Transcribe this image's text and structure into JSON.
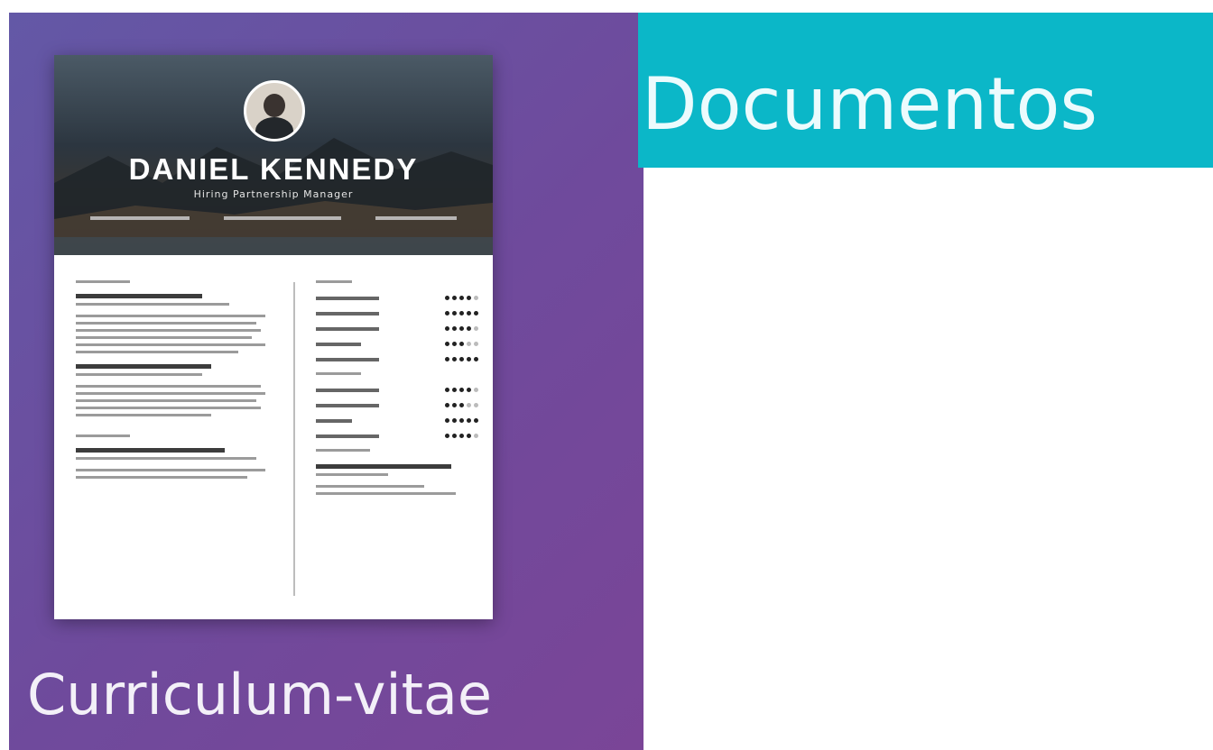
{
  "tiles": {
    "cv": {
      "label": "Curriculum-vitae",
      "accent": "#6f4a9c",
      "thumbnail": {
        "name": "DANIEL KENNEDY",
        "role": "Hiring Partnership Manager"
      }
    },
    "documents": {
      "label": "Documentos",
      "accent": "#0bb7c8"
    }
  }
}
